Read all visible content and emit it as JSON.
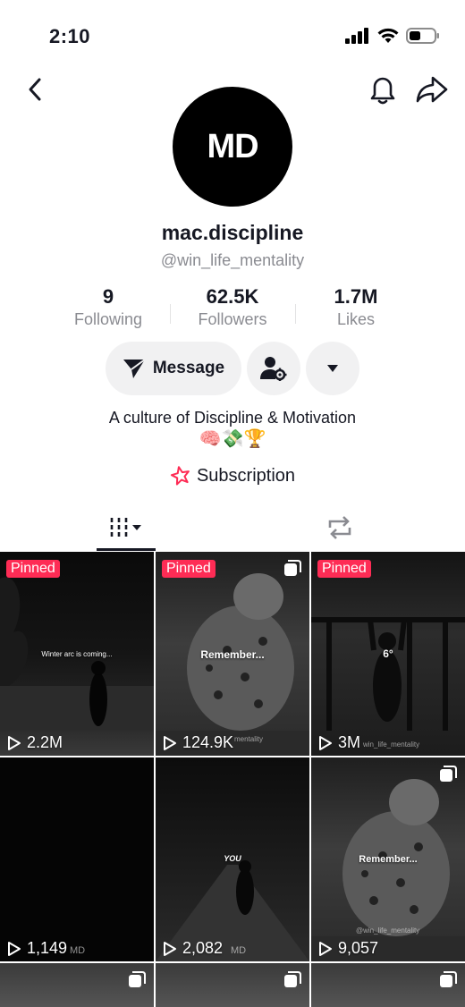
{
  "status": {
    "time": "2:10"
  },
  "profile": {
    "avatar_initials": "MD",
    "display_name": "mac.discipline",
    "username": "@win_life_mentality"
  },
  "stats": [
    {
      "value": "9",
      "label": "Following"
    },
    {
      "value": "62.5K",
      "label": "Followers"
    },
    {
      "value": "1.7M",
      "label": "Likes"
    }
  ],
  "actions": {
    "message_label": "Message"
  },
  "bio": {
    "text": "A culture of Discipline & Motivation",
    "emoji": "🧠💸🏆"
  },
  "subscription": {
    "label": "Subscription"
  },
  "videos": [
    {
      "pinned": "Pinned",
      "views": "2.2M",
      "caption": "Winter arc is coming...",
      "watermark": ""
    },
    {
      "pinned": "Pinned",
      "views": "124.9K",
      "caption": "Remember...",
      "watermark": "mentality"
    },
    {
      "pinned": "Pinned",
      "views": "3M",
      "caption": "6°",
      "watermark": "win_life_mentality"
    },
    {
      "pinned": "",
      "views": "1,149",
      "caption": "",
      "watermark": "MD"
    },
    {
      "pinned": "",
      "views": "2,082",
      "caption": "YOU",
      "watermark": "MD"
    },
    {
      "pinned": "",
      "views": "9,057",
      "caption": "Remember...",
      "watermark": "@win_life_mentality"
    }
  ],
  "colors": {
    "accent": "#fe2c55",
    "text": "#161823",
    "muted": "#8a8b91",
    "button_bg": "#f1f1f2"
  }
}
